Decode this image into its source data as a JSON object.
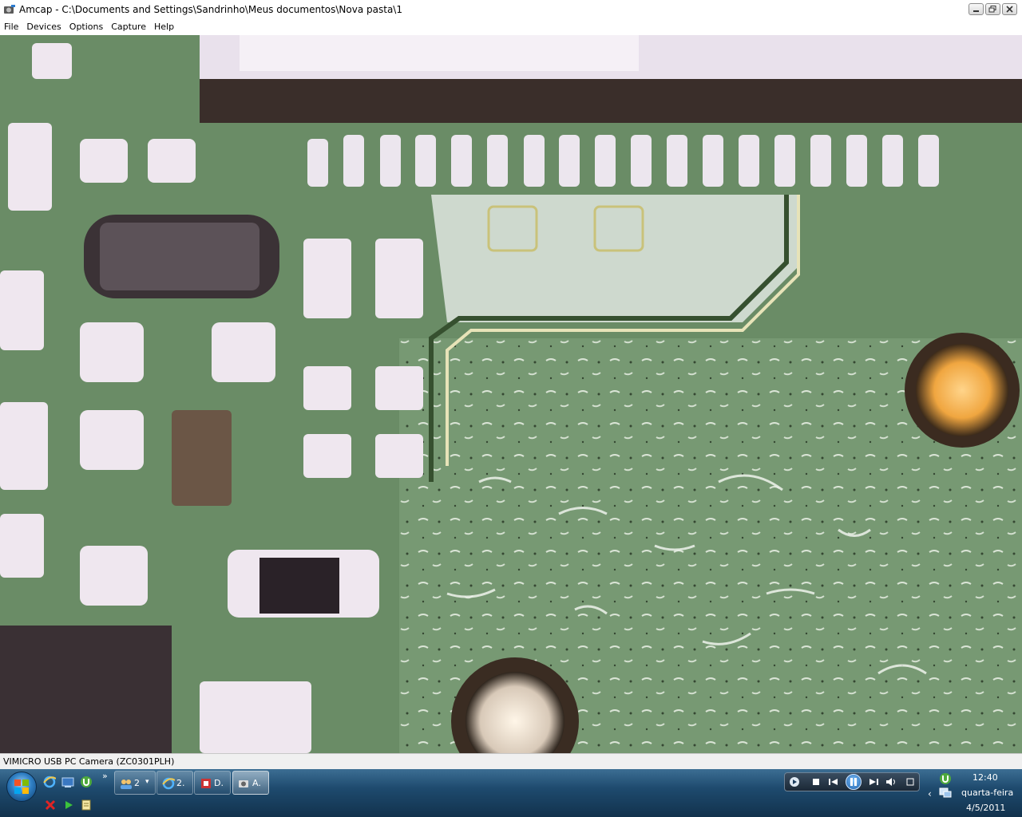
{
  "window": {
    "title": "Amcap - C:\\Documents and Settings\\Sandrinho\\Meus documentos\\Nova pasta\\1",
    "app_icon": "camera-app-icon",
    "controls": [
      "minimize-icon",
      "restore-icon",
      "close-icon"
    ]
  },
  "menu": {
    "items": [
      {
        "label": "File"
      },
      {
        "label": "Devices"
      },
      {
        "label": "Options"
      },
      {
        "label": "Capture"
      },
      {
        "label": "Help"
      }
    ]
  },
  "video": {
    "content": "live-camera-feed-pcb",
    "colors": {
      "board": "#6d8f6a",
      "pad": "#e8e2ea",
      "trace": "#3f5a3c",
      "via": "#e8a93a"
    }
  },
  "statusbar": {
    "text": "VIMICRO USB PC Camera (ZC0301PLH)"
  },
  "taskbar": {
    "start_icon": "windows-start-icon",
    "quick_launch": [
      "internet-explorer-icon",
      "show-desktop-icon",
      "utorrent-icon"
    ],
    "quick_launch_more": "»",
    "tasks": [
      {
        "icon": "group-icon",
        "label": "2",
        "caret": "▾"
      },
      {
        "icon": "internet-explorer-icon",
        "label": "2."
      },
      {
        "icon": "app-icon",
        "label": "D."
      },
      {
        "icon": "camera-app-icon",
        "label": "A."
      }
    ],
    "media_buttons": [
      "stop-icon",
      "previous-icon",
      "pause-icon",
      "next-icon",
      "volume-icon"
    ],
    "tray": {
      "icons": [
        "utorrent-icon",
        "network-icon"
      ],
      "chevron": "‹",
      "time": "12:40",
      "day": "quarta-feira",
      "date": "4/5/2011"
    },
    "bottom_icons": [
      "red-x-icon",
      "green-play-icon",
      "notepad-icon"
    ]
  }
}
